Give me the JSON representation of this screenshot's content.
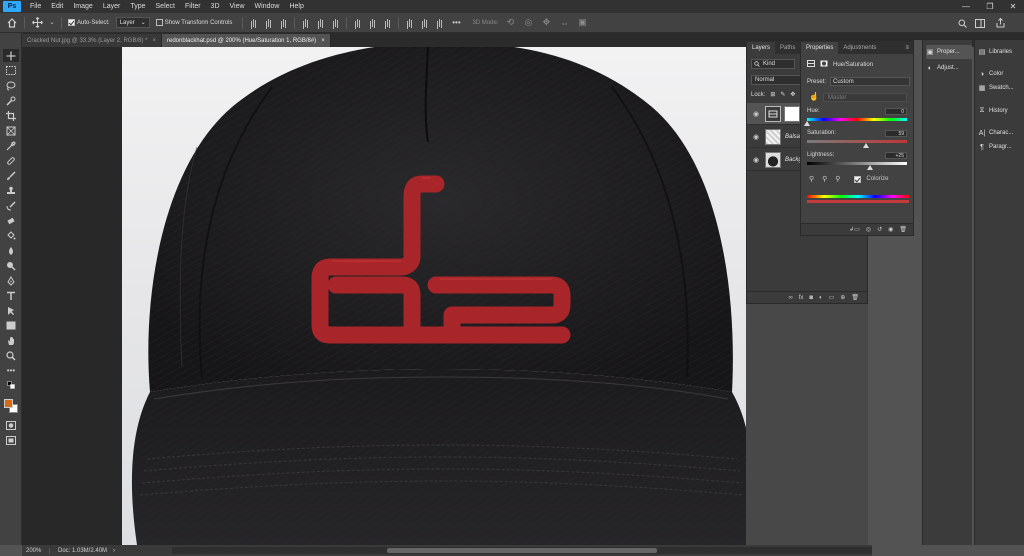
{
  "menu": {
    "items": [
      "File",
      "Edit",
      "Image",
      "Layer",
      "Type",
      "Select",
      "Filter",
      "3D",
      "View",
      "Window",
      "Help"
    ],
    "app_badge": "Ps",
    "win_minimize": "—",
    "win_restore": "❐",
    "win_close": "✕"
  },
  "options_bar": {
    "auto_select_label": "Auto-Select:",
    "auto_select_checked": true,
    "auto_select_target": "Layer",
    "show_transform_label": "Show Transform Controls",
    "show_transform_checked": false,
    "mode_3d_label": "3D Mode:"
  },
  "tabs": [
    {
      "label": "Cracked Nut.jpg @ 33.3% (Layer 2, RGB/8) *",
      "active": false,
      "close": "×"
    },
    {
      "label": "redonblackhat.psd @ 200% (Hue/Saturation 1, RGB/8#)",
      "active": true,
      "close": "×"
    }
  ],
  "status_bar": {
    "zoom": "200%",
    "doc": "Doc: 1.03M/2.40M",
    "arrow": "›"
  },
  "layers_panel": {
    "tabs": [
      "Layers",
      "Paths"
    ],
    "active_tab": "Layers",
    "filter_label": "Kind",
    "blend_mode": "Normal",
    "lock_label": "Lock:",
    "layers": [
      {
        "name": "",
        "type": "adjustment",
        "selected": true
      },
      {
        "name": "Balsa",
        "type": "pattern",
        "selected": false
      },
      {
        "name": "Backgr",
        "type": "image",
        "selected": false
      }
    ],
    "footer_icons": [
      "link-icon",
      "fx-icon",
      "mask-icon",
      "adjustment-icon",
      "group-icon",
      "new-layer-icon",
      "trash-icon"
    ]
  },
  "properties_panel": {
    "tabs": [
      "Properties",
      "Adjustments"
    ],
    "active_tab": "Properties",
    "adjustment_title": "Hue/Saturation",
    "preset_label": "Preset:",
    "preset_value": "Custom",
    "channel_value": "Master",
    "hue_label": "Hue:",
    "hue_value": "0",
    "saturation_label": "Saturation:",
    "saturation_value": "59",
    "lightness_label": "Lightness:",
    "lightness_value": "+25",
    "colorize_label": "Colorize",
    "colorize_checked": true,
    "hue_level": 0.0,
    "saturation_level": 0.59,
    "lightness_level": 0.625
  },
  "mini_dock": {
    "items": [
      {
        "label": "Proper...",
        "icon": "properties-icon"
      },
      {
        "label": "Adjust...",
        "icon": "adjustments-icon"
      }
    ]
  },
  "right_dock": {
    "items": [
      {
        "label": "Libraries",
        "icon": "libraries-icon"
      },
      {
        "label": "Color",
        "icon": "color-icon"
      },
      {
        "label": "Swatch...",
        "icon": "swatches-icon"
      },
      {
        "label": "History",
        "icon": "history-icon"
      },
      {
        "label": "Charac...",
        "icon": "character-icon"
      },
      {
        "label": "Paragr...",
        "icon": "paragraph-icon"
      }
    ]
  },
  "colors": {
    "foreground": "#d56a10",
    "background": "#ffffff",
    "logo_red": "#a8262a",
    "hat_black": "#1e1d1f"
  }
}
